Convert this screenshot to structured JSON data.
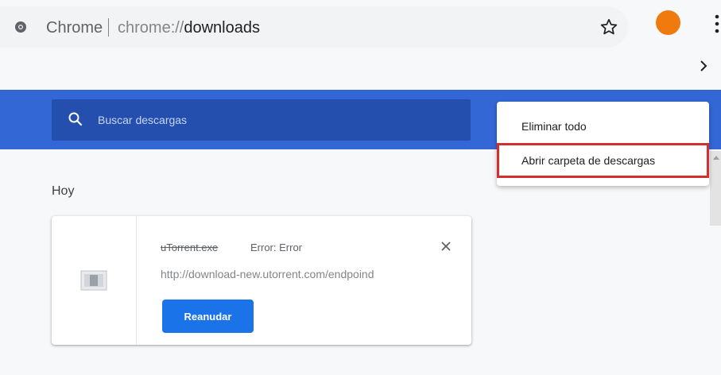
{
  "omnibox": {
    "site_chip": "Chrome",
    "url_scheme": "chrome://",
    "url_path": "downloads",
    "icons": [
      "site-info-icon",
      "bookmark-star-icon",
      "more-vert-icon",
      "chevron-right-icon"
    ],
    "avatar_color": "#ef7a0e"
  },
  "toolbar": {
    "color": "#3367d6",
    "search_placeholder": "Buscar descargas"
  },
  "section": {
    "title": "Hoy"
  },
  "download": {
    "file_name": "uTorrent.exe",
    "status": "Error: Error",
    "url": "http://download-new.utorrent.com/endpoind",
    "resume_label": "Reanudar"
  },
  "menu": {
    "items": [
      {
        "label": "Eliminar todo"
      },
      {
        "label": "Abrir carpeta de descargas",
        "highlighted": true
      }
    ],
    "highlight_color": "#d32f2f"
  }
}
